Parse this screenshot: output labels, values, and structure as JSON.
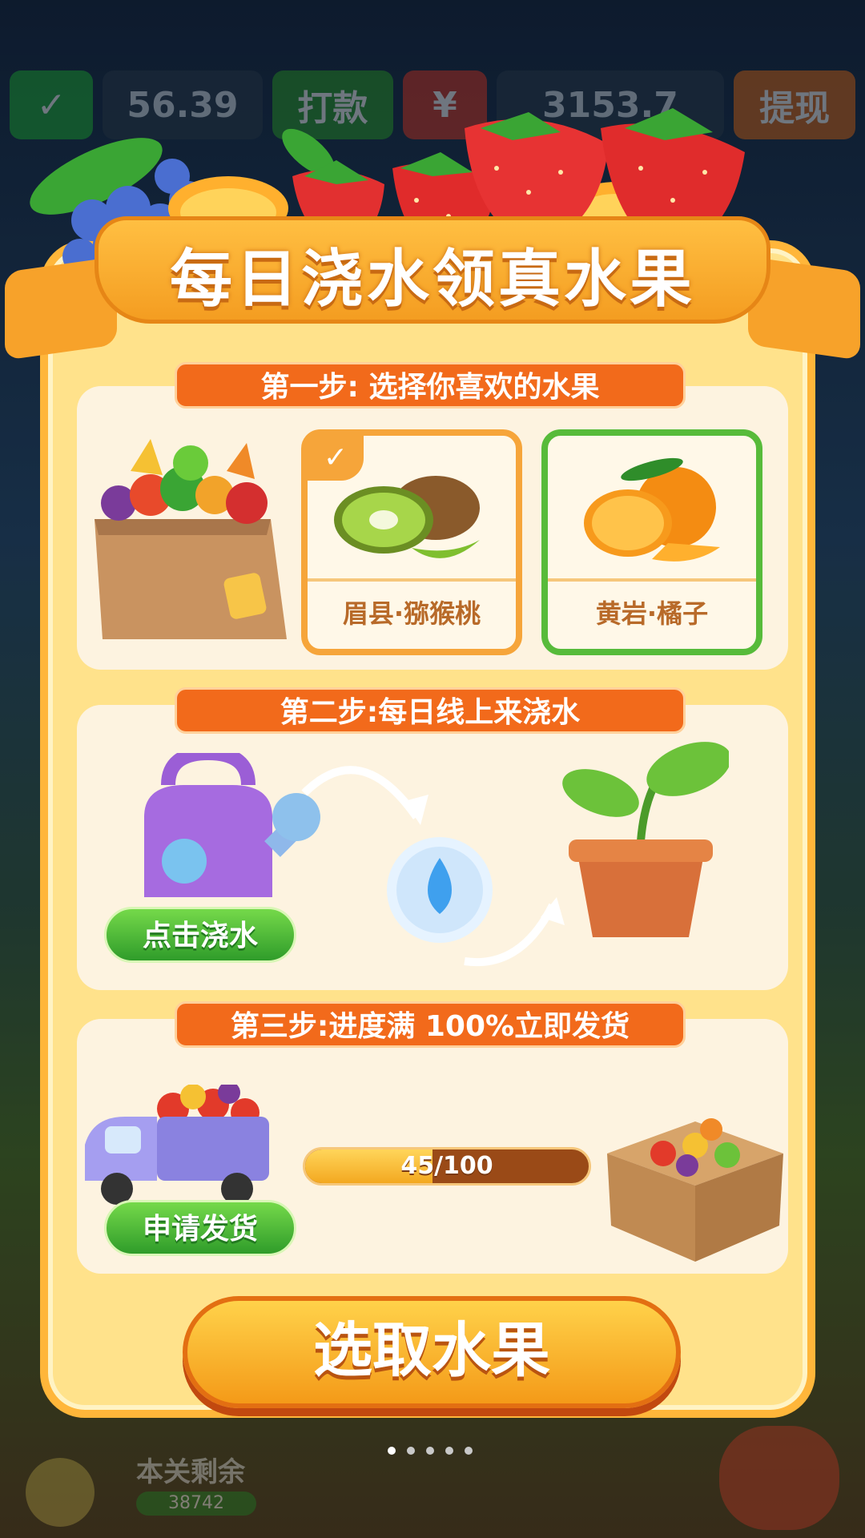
{
  "background": {
    "wallet_amount": "56.39",
    "payout_button": "打款",
    "coin_amount": "3153.7",
    "withdraw_button": "提现",
    "remaining_label": "本关剩余",
    "remaining_count": "38742"
  },
  "dialog": {
    "title": "每日浇水领真水果",
    "step1": {
      "label": "第一步: 选择你喜欢的水果",
      "options": [
        {
          "name": "眉县·猕猴桃",
          "selected": true
        },
        {
          "name": "黄岩·橘子",
          "selected": false
        }
      ]
    },
    "step2": {
      "label": "第二步:每日线上来浇水",
      "button": "点击浇水"
    },
    "step3": {
      "label": "第三步:进度满 100%立即发货",
      "progress_text": "45/100",
      "progress_fraction": 0.45,
      "button": "申请发货"
    },
    "cta": "选取水果"
  },
  "pager": {
    "count": 5,
    "active": 0
  },
  "colors": {
    "accent": "#f26a1b",
    "panel": "#ffe28b",
    "green": "#57bb3a"
  }
}
